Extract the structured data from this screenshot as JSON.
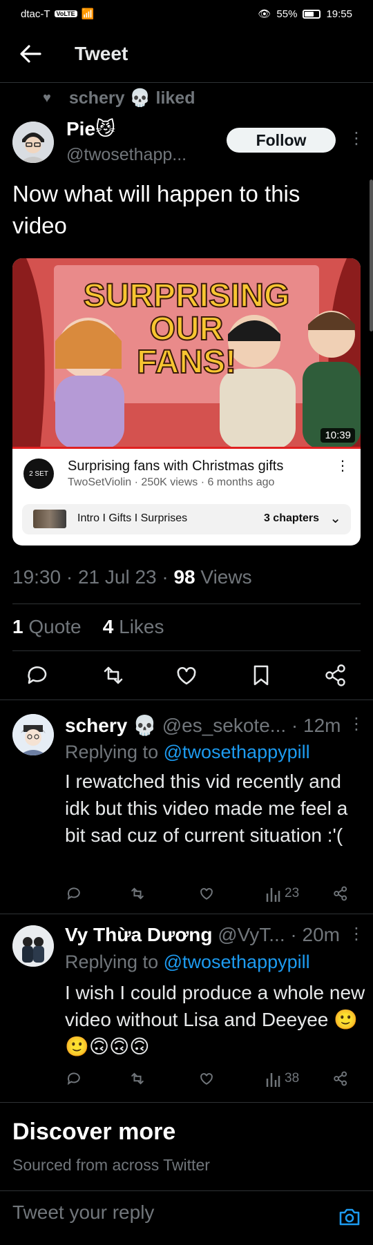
{
  "status_bar": {
    "carrier": "dtac-T",
    "volte": "VoLTE",
    "battery": "55%",
    "battery_level": 0.55,
    "time": "19:55"
  },
  "header": {
    "title": "Tweet"
  },
  "social_context": {
    "text": "schery 💀 liked"
  },
  "tweet": {
    "author_name": "Pie😼",
    "author_handle": "@twosethapp...",
    "follow_label": "Follow",
    "text": "Now what will happen to this video",
    "time": "19:30 · 21 Jul 23 · ",
    "views_count": "98",
    "views_label": " Views",
    "quotes_count": "1",
    "quotes_label": " Quote",
    "likes_count": "4",
    "likes_label": " Likes"
  },
  "youtube_card": {
    "thumbnail_text": "SURPRISING OUR FANS!",
    "duration": "10:39",
    "channel_logo": "2 SET",
    "title": "Surprising fans with Christmas gifts",
    "meta": "TwoSetViolin · 250K views · 6 months ago",
    "chapters_text": "Intro I Gifts I Surprises",
    "chapters_count": "3 chapters"
  },
  "replies": [
    {
      "name": "schery 💀",
      "handle": "@es_sekote... · 12m",
      "replying_prefix": "Replying to ",
      "replying_to": "@twosethappypill",
      "body": "I rewatched this vid recently and idk but this video made me feel a bit sad cuz of current situation :'(",
      "views": "23"
    },
    {
      "name": "Vy Thừa Dương",
      "handle": "@VyT... · 20m",
      "replying_prefix": "Replying to ",
      "replying_to": "@twosethappypill",
      "body": "I wish I could produce a whole new video without Lisa and Deeyee 🙂🙂🙃🙃🙃",
      "views": "38"
    }
  ],
  "discover": {
    "title": "Discover more",
    "subtitle": "Sourced from across Twitter"
  },
  "reply_input": {
    "placeholder": "Tweet your reply"
  },
  "icons": {
    "back": "arrow-left-icon",
    "reply": "comment-icon",
    "retweet": "retweet-icon",
    "like": "heart-icon",
    "bookmark": "bookmark-icon",
    "share": "share-icon",
    "analytics": "analytics-icon",
    "camera": "camera-icon"
  },
  "colors": {
    "accent": "#1d9bf0",
    "background": "#000000",
    "muted": "#71767b"
  }
}
